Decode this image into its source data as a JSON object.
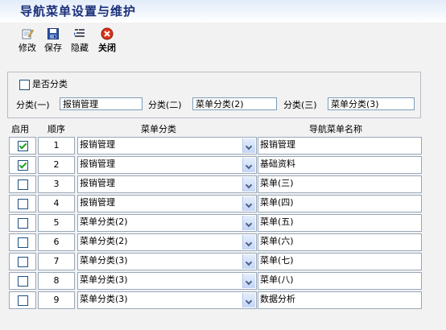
{
  "window": {
    "title": "导航菜单设置与维护"
  },
  "toolbar": {
    "edit_label": "修改",
    "save_label": "保存",
    "hide_label": "隐藏",
    "close_label": "关闭"
  },
  "category_settings": {
    "checkbox_label": "是否分类",
    "checkbox_checked": false,
    "cat1_label": "分类(一)",
    "cat1_value": "报销管理",
    "cat2_label": "分类(二)",
    "cat2_value": "菜单分类(2)",
    "cat3_label": "分类(三)",
    "cat3_value": "菜单分类(3)"
  },
  "table": {
    "headers": {
      "enabled": "启用",
      "order": "顺序",
      "category": "菜单分类",
      "name": "导航菜单名称"
    },
    "rows": [
      {
        "enabled": true,
        "order": "1",
        "category": "报销管理",
        "name": "报销管理"
      },
      {
        "enabled": true,
        "order": "2",
        "category": "报销管理",
        "name": "基础资料"
      },
      {
        "enabled": false,
        "order": "3",
        "category": "报销管理",
        "name": "菜单(三)"
      },
      {
        "enabled": false,
        "order": "4",
        "category": "报销管理",
        "name": "菜单(四)"
      },
      {
        "enabled": false,
        "order": "5",
        "category": "菜单分类(2)",
        "name": "菜单(五)"
      },
      {
        "enabled": false,
        "order": "6",
        "category": "菜单分类(2)",
        "name": "菜单(六)"
      },
      {
        "enabled": false,
        "order": "7",
        "category": "菜单分类(3)",
        "name": "菜单(七)"
      },
      {
        "enabled": false,
        "order": "8",
        "category": "菜单分类(3)",
        "name": "菜单(八)"
      },
      {
        "enabled": false,
        "order": "9",
        "category": "菜单分类(3)",
        "name": "数据分析"
      }
    ]
  },
  "icons": {
    "edit": "edit-icon",
    "save": "save-icon",
    "hide": "hide-icon",
    "close": "close-icon",
    "checkmark_color": "#21a121",
    "close_color": "#d9341c"
  }
}
